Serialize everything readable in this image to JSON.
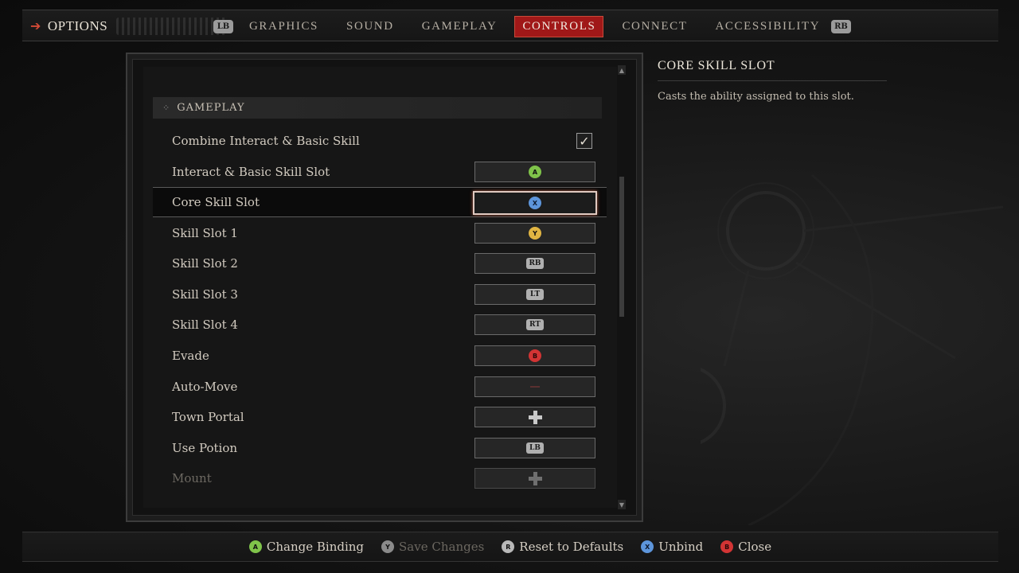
{
  "topbar": {
    "options_label": "OPTIONS",
    "lb_label": "LB",
    "rb_label": "RB",
    "tabs": [
      "GRAPHICS",
      "SOUND",
      "GAMEPLAY",
      "CONTROLS",
      "CONNECT",
      "ACCESSIBILITY"
    ],
    "active_tab": "CONTROLS"
  },
  "section": {
    "title": "GAMEPLAY"
  },
  "rows": [
    {
      "label": "Combine Interact & Basic Skill",
      "type": "checkbox",
      "checked": true,
      "check_glyph": "✓"
    },
    {
      "label": "Interact & Basic Skill Slot",
      "button": "A"
    },
    {
      "label": "Core Skill Slot",
      "button": "X",
      "selected": true
    },
    {
      "label": "Skill Slot 1",
      "button": "Y"
    },
    {
      "label": "Skill Slot 2",
      "button": "RB"
    },
    {
      "label": "Skill Slot 3",
      "button": "LT"
    },
    {
      "label": "Skill Slot 4",
      "button": "RT"
    },
    {
      "label": "Evade",
      "button": "B"
    },
    {
      "label": "Auto-Move",
      "button": ""
    },
    {
      "label": "Town Portal",
      "button": "dpad-icon"
    },
    {
      "label": "Use Potion",
      "button": "LB"
    },
    {
      "label": "Mount",
      "button": "dpad-icon",
      "dim": true
    }
  ],
  "description": {
    "title": "CORE SKILL SLOT",
    "text": "Casts the ability assigned to this slot."
  },
  "footer": {
    "hints": [
      {
        "button": "A",
        "label": "Change Binding"
      },
      {
        "button": "Y",
        "label": "Save Changes",
        "dim": true
      },
      {
        "button": "R",
        "label": "Reset to Defaults"
      },
      {
        "button": "X",
        "label": "Unbind"
      },
      {
        "button": "B",
        "label": "Close"
      }
    ]
  },
  "colors": {
    "accent_red": "#a01818",
    "button_a": "#7fc34a",
    "button_x": "#5d95db",
    "button_y": "#e0b442",
    "button_b": "#d23434"
  }
}
